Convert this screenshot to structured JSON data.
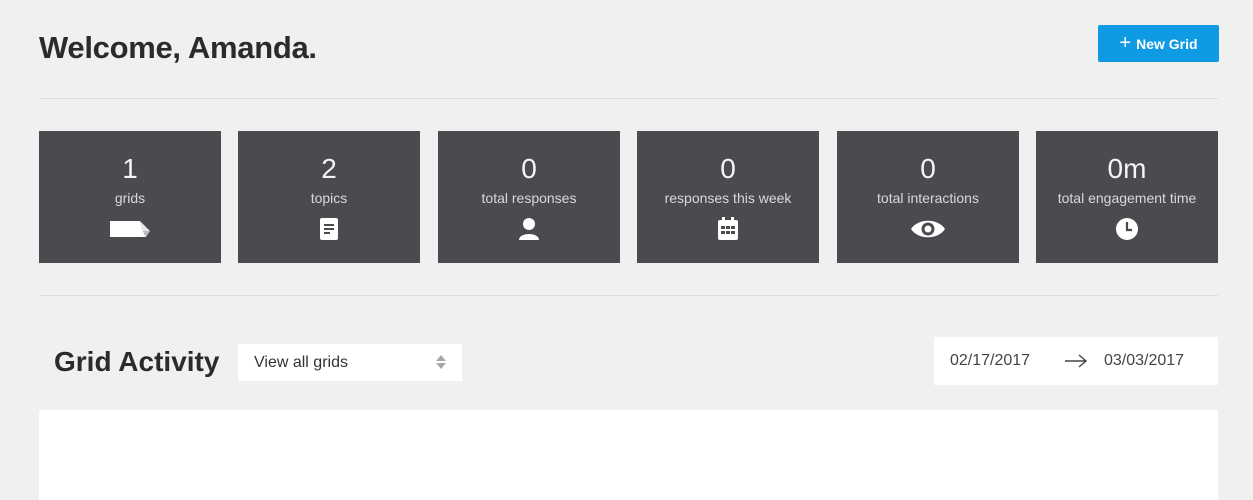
{
  "header": {
    "title": "Welcome, Amanda.",
    "new_grid_label": "New Grid"
  },
  "stats": [
    {
      "value": "1",
      "label": "grids",
      "icon": "grid-icon"
    },
    {
      "value": "2",
      "label": "topics",
      "icon": "document-icon"
    },
    {
      "value": "0",
      "label": "total responses",
      "icon": "user-icon"
    },
    {
      "value": "0",
      "label": "responses this week",
      "icon": "calendar-icon"
    },
    {
      "value": "0",
      "label": "total interactions",
      "icon": "eye-icon"
    },
    {
      "value": "0m",
      "label": "total engagement time",
      "icon": "clock-icon"
    }
  ],
  "activity": {
    "title": "Grid Activity",
    "filter_value": "View all grids",
    "date_start": "02/17/2017",
    "date_end": "03/03/2017"
  },
  "colors": {
    "accent": "#0e9be3",
    "tile": "#4b4a4f",
    "background": "#f0f0f0"
  }
}
